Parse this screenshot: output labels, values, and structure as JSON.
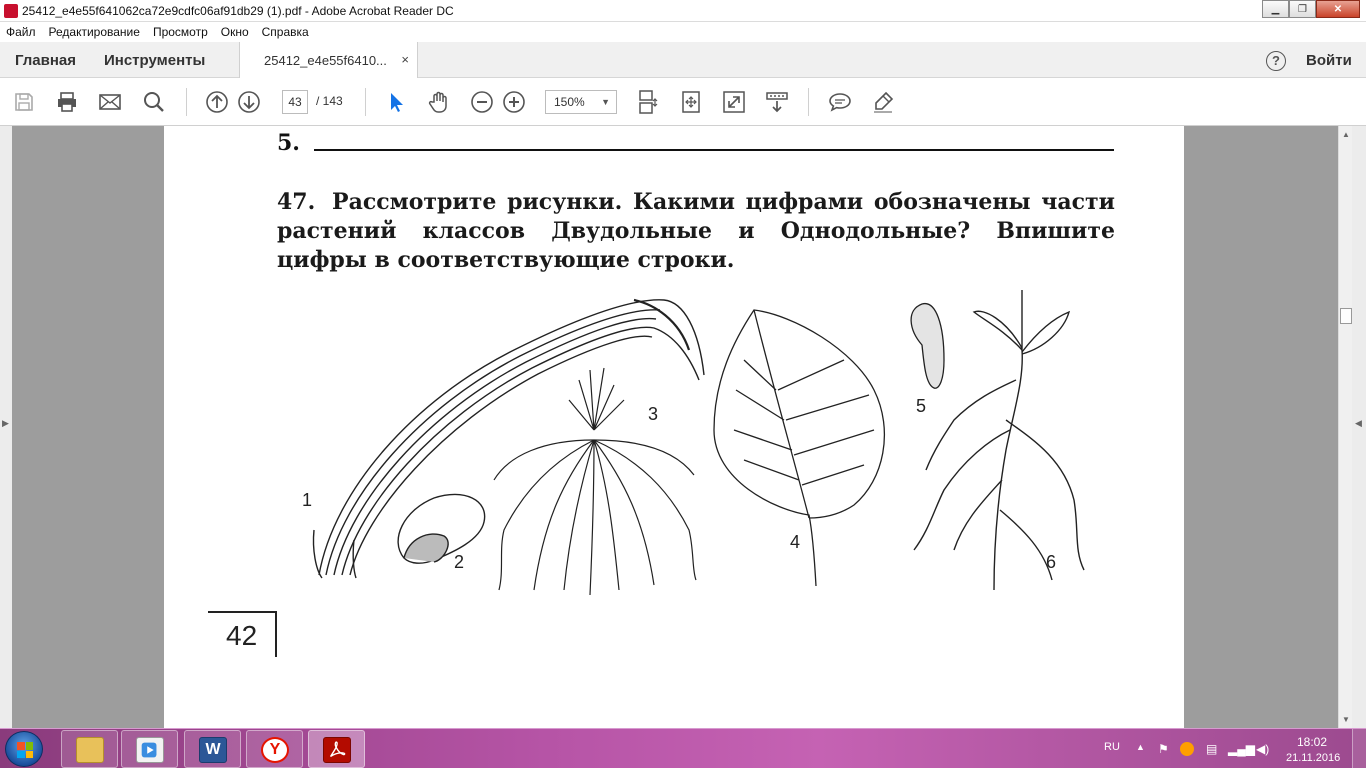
{
  "window": {
    "title": "25412_e4e55f641062ca72e9cdfc06af91db29 (1).pdf - Adobe Acrobat Reader DC"
  },
  "menu": [
    "Файл",
    "Редактирование",
    "Просмотр",
    "Окно",
    "Справка"
  ],
  "tabbar": {
    "home": "Главная",
    "tools": "Инструменты",
    "document_tab": "25412_e4e55f6410...",
    "close_glyph": "×",
    "help_glyph": "?",
    "sign_in": "Войти"
  },
  "toolbar": {
    "icons": [
      "save-icon",
      "print-icon",
      "email-icon",
      "search-icon",
      "page-up-icon",
      "page-down-icon",
      "select-icon",
      "hand-icon",
      "zoom-out-icon",
      "zoom-in-icon",
      "scroll-mode-icon",
      "fit-page-icon",
      "full-screen-icon",
      "read-mode-icon",
      "comment-icon",
      "highlight-icon"
    ],
    "page_current": "43",
    "page_total": "/ 143",
    "zoom": "150%"
  },
  "document": {
    "previous_item": "5.",
    "question_number": "47.",
    "question_text": "Рассмотрите рисунки. Какими цифрами обозначены части растений классов Двудольные и Однодольные? Впишите цифры в соответствующие строки.",
    "figure_labels": [
      "1",
      "2",
      "3",
      "4",
      "5",
      "6"
    ],
    "page_number": "42"
  },
  "taskbar": {
    "apps": [
      "file-explorer-icon",
      "media-player-icon",
      "word-icon",
      "yandex-browser-icon",
      "acrobat-icon"
    ],
    "language": "RU",
    "time": "18:02",
    "date": "21.11.2016"
  }
}
